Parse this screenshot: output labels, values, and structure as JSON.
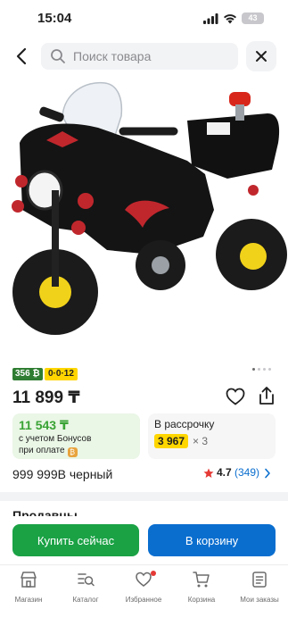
{
  "status_bar": {
    "time": "15:04",
    "battery": "43"
  },
  "search": {
    "placeholder": "Поиск товара"
  },
  "product": {
    "badge_bonus": "356 ₿",
    "badge_installment": "0·0·12",
    "price": "11 899 ₸",
    "bonus_price": "11 543 ₸",
    "bonus_line1": "с учетом Бонусов",
    "bonus_line2": "при оплате",
    "installment_title": "В рассрочку",
    "installment_amount": "3 967",
    "installment_term": "× 3",
    "variant": "999 999B черный",
    "rating": "4.7",
    "review_count": "(349)"
  },
  "sellers": {
    "heading": "Продавцы"
  },
  "actions": {
    "buy_now": "Купить сейчас",
    "add_to_cart": "В корзину"
  },
  "tabs": [
    {
      "label": "Магазин",
      "icon": "store-icon"
    },
    {
      "label": "Каталог",
      "icon": "catalog-icon"
    },
    {
      "label": "Избранное",
      "icon": "heart-icon"
    },
    {
      "label": "Корзина",
      "icon": "cart-icon"
    },
    {
      "label": "Мои заказы",
      "icon": "orders-icon"
    }
  ],
  "colors": {
    "accent_green": "#1aa245",
    "accent_blue": "#0a6ecf",
    "badge_yellow": "#ffd600",
    "bonus_green": "#3aa335"
  }
}
